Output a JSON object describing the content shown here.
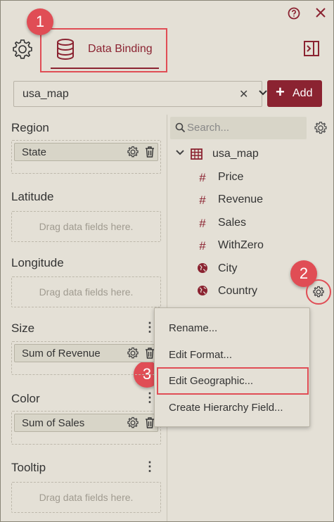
{
  "header": {
    "help_icon": "help-circle-icon",
    "close_icon": "close-icon"
  },
  "tabs": {
    "settings_icon": "gear-icon",
    "data_binding_label": "Data Binding",
    "panel_icon": "panel-toggle-icon"
  },
  "badges": [
    "1",
    "2",
    "3"
  ],
  "datasource": {
    "value": "usa_map",
    "add_label": "Add"
  },
  "sections": [
    {
      "title": "Region",
      "chip": "State",
      "hint": ""
    },
    {
      "title": "Latitude",
      "chip": "",
      "hint": "Drag data fields here."
    },
    {
      "title": "Longitude",
      "chip": "",
      "hint": "Drag data fields here."
    },
    {
      "title": "Size",
      "chip": "Sum of Revenue",
      "hint": ""
    },
    {
      "title": "Color",
      "chip": "Sum of Sales",
      "hint": ""
    },
    {
      "title": "Tooltip",
      "chip": "",
      "hint": "Drag data fields here."
    }
  ],
  "search": {
    "placeholder": "Search..."
  },
  "tree": {
    "root": "usa_map",
    "fields": [
      {
        "icon": "#",
        "label": "Price"
      },
      {
        "icon": "#",
        "label": "Revenue"
      },
      {
        "icon": "#",
        "label": "Sales"
      },
      {
        "icon": "#",
        "label": "WithZero"
      },
      {
        "icon": "globe",
        "label": "City"
      },
      {
        "icon": "globe",
        "label": "Country"
      }
    ]
  },
  "context_menu": {
    "items": [
      "Rename...",
      "Edit Format...",
      "Edit Geographic...",
      "Create Hierarchy Field..."
    ]
  },
  "colors": {
    "accent": "#8b2331",
    "highlight": "#e04d55",
    "background": "#e4e0d6"
  }
}
